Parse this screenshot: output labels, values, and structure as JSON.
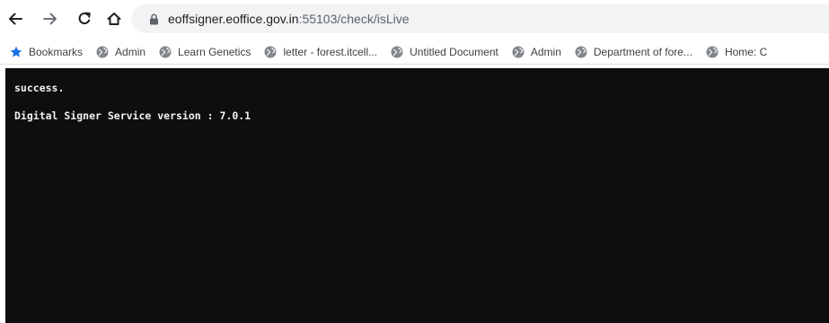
{
  "address_bar": {
    "host": "eoffsigner.eoffice.gov.in",
    "path": ":55103/check/isLive"
  },
  "bookmarks": [
    {
      "label": "Bookmarks",
      "icon": "star-icon"
    },
    {
      "label": "Admin",
      "icon": "globe-icon"
    },
    {
      "label": "Learn Genetics",
      "icon": "globe-icon"
    },
    {
      "label": "letter - forest.itcell...",
      "icon": "globe-icon"
    },
    {
      "label": "Untitled Document",
      "icon": "globe-icon"
    },
    {
      "label": "Admin",
      "icon": "globe-icon"
    },
    {
      "label": "Department of fore...",
      "icon": "globe-icon"
    },
    {
      "label": "Home: C",
      "icon": "globe-icon"
    }
  ],
  "page": {
    "line1": "success.",
    "line2": "Digital Signer Service version : 7.0.1"
  },
  "colors": {
    "page_background": "#0e0e0e",
    "page_text": "#f2f2f2",
    "star": "#1a73e8",
    "omnibox": "#f1f3f4"
  }
}
